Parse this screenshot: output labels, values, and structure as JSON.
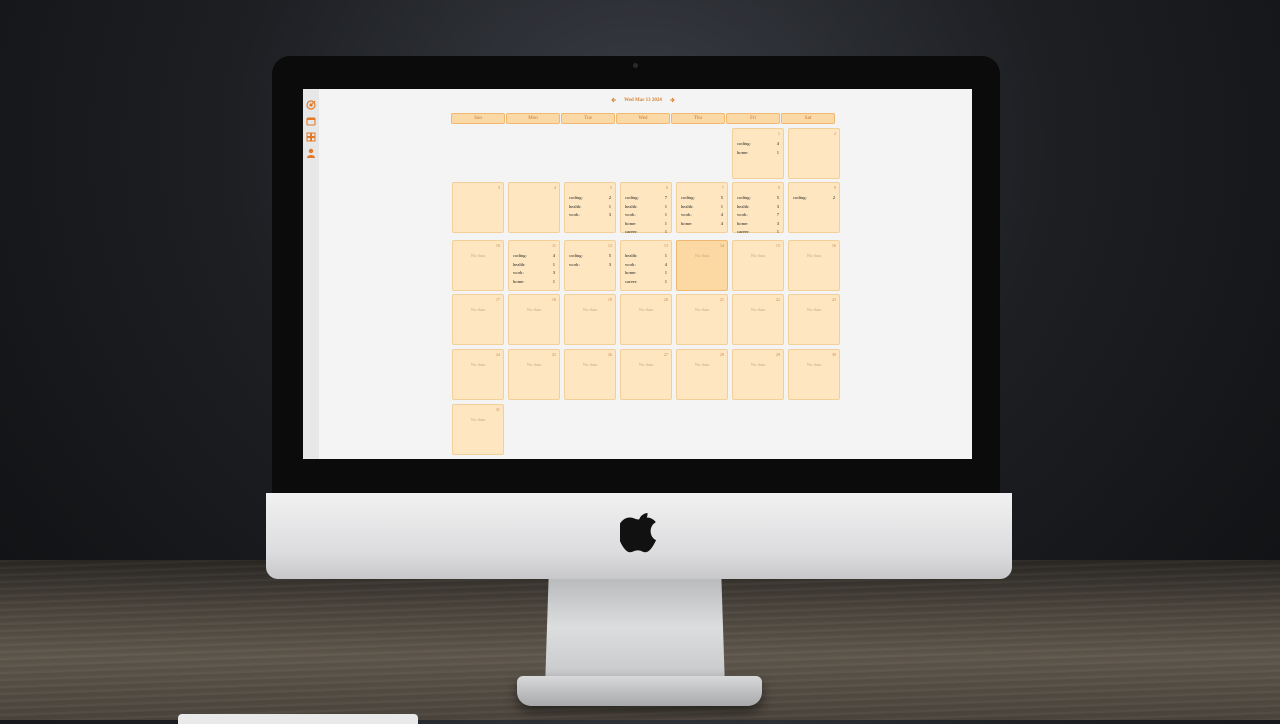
{
  "app": {
    "current_date": "Wed Mar 13 2024",
    "weekdays": [
      "Sun",
      "Mon",
      "Tue",
      "Wed",
      "Thu",
      "Fri",
      "Sat"
    ],
    "no_data_label": "No data",
    "accent_color": "#d9802a",
    "sidebar_icons": [
      "target-icon",
      "calendar-icon",
      "grid-icon",
      "user-icon"
    ]
  },
  "calendar": {
    "days": [
      {
        "day": "1",
        "entries": [
          {
            "label": "coding:",
            "value": "4"
          },
          {
            "label": "home:",
            "value": "1"
          }
        ]
      },
      {
        "day": "2",
        "entries": []
      },
      {
        "day": "3",
        "entries": []
      },
      {
        "day": "4",
        "entries": []
      },
      {
        "day": "5",
        "entries": [
          {
            "label": "coding:",
            "value": "2"
          },
          {
            "label": "health:",
            "value": "1"
          },
          {
            "label": "work:",
            "value": "3"
          }
        ]
      },
      {
        "day": "6",
        "entries": [
          {
            "label": "coding:",
            "value": "7"
          },
          {
            "label": "health:",
            "value": "1"
          },
          {
            "label": "work:",
            "value": "1"
          },
          {
            "label": "home:",
            "value": "1"
          },
          {
            "label": "career:",
            "value": "1"
          }
        ]
      },
      {
        "day": "7",
        "entries": [
          {
            "label": "coding:",
            "value": "5"
          },
          {
            "label": "health:",
            "value": "1"
          },
          {
            "label": "work:",
            "value": "4"
          },
          {
            "label": "home:",
            "value": "4"
          }
        ]
      },
      {
        "day": "8",
        "entries": [
          {
            "label": "coding:",
            "value": "5"
          },
          {
            "label": "health:",
            "value": "3"
          },
          {
            "label": "work:",
            "value": "7"
          },
          {
            "label": "home:",
            "value": "3"
          },
          {
            "label": "career:",
            "value": "1"
          }
        ]
      },
      {
        "day": "9",
        "entries": [
          {
            "label": "coding:",
            "value": "2"
          }
        ]
      },
      {
        "day": "10",
        "no_data": true
      },
      {
        "day": "11",
        "entries": [
          {
            "label": "coding:",
            "value": "4"
          },
          {
            "label": "health:",
            "value": "1"
          },
          {
            "label": "work:",
            "value": "3"
          },
          {
            "label": "home:",
            "value": "1"
          }
        ]
      },
      {
        "day": "12",
        "entries": [
          {
            "label": "coding:",
            "value": "5"
          },
          {
            "label": "work:",
            "value": "3"
          }
        ]
      },
      {
        "day": "13",
        "entries": [
          {
            "label": "health:",
            "value": "1"
          },
          {
            "label": "work:",
            "value": "4"
          },
          {
            "label": "home:",
            "value": "1"
          },
          {
            "label": "career:",
            "value": "1"
          }
        ]
      },
      {
        "day": "14",
        "no_data": true,
        "today": true
      },
      {
        "day": "15",
        "no_data": true
      },
      {
        "day": "16",
        "no_data": true
      },
      {
        "day": "17",
        "no_data": true
      },
      {
        "day": "18",
        "no_data": true
      },
      {
        "day": "19",
        "no_data": true
      },
      {
        "day": "20",
        "no_data": true
      },
      {
        "day": "21",
        "no_data": true
      },
      {
        "day": "22",
        "no_data": true
      },
      {
        "day": "23",
        "no_data": true
      },
      {
        "day": "24",
        "no_data": true
      },
      {
        "day": "25",
        "no_data": true
      },
      {
        "day": "26",
        "no_data": true
      },
      {
        "day": "27",
        "no_data": true
      },
      {
        "day": "28",
        "no_data": true
      },
      {
        "day": "29",
        "no_data": true
      },
      {
        "day": "30",
        "no_data": true
      },
      {
        "day": "31",
        "no_data": true
      }
    ]
  }
}
